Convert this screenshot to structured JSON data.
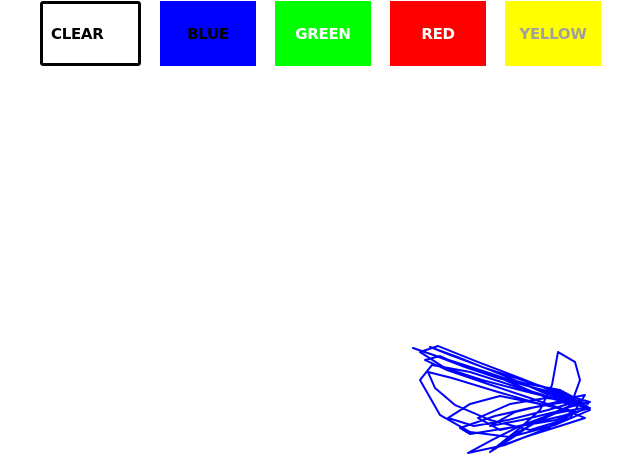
{
  "toolbar": {
    "buttons": [
      {
        "id": "clear",
        "label": "CLEAR",
        "bg": "#ffffff",
        "fg": "#000000"
      },
      {
        "id": "blue",
        "label": "BLUE",
        "bg": "#0000ff",
        "fg": "#000000"
      },
      {
        "id": "green",
        "label": "GREEN",
        "bg": "#00ff00",
        "fg": "#ffffff"
      },
      {
        "id": "red",
        "label": "RED",
        "bg": "#ff0000",
        "fg": "#ffffff"
      },
      {
        "id": "yellow",
        "label": "YELLOW",
        "bg": "#ffff00",
        "fg": "#a0a0a0"
      }
    ]
  },
  "canvas": {
    "background": "#ffffff",
    "stroke_color": "#0000ff"
  }
}
